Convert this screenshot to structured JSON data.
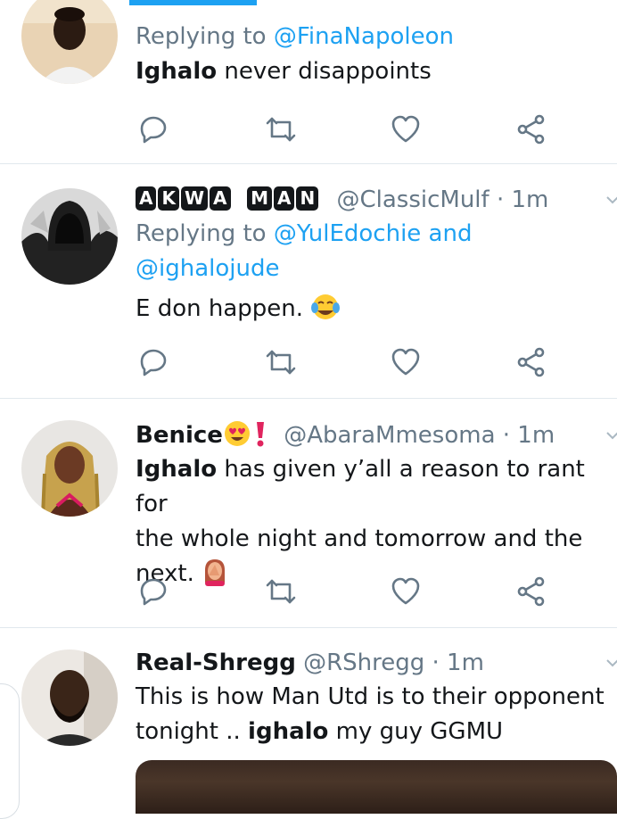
{
  "tweets": [
    {
      "name": "",
      "handle": "",
      "time": "",
      "replying_prefix": "Replying to",
      "replying_to": "@FinaNapoleon",
      "replying_to_2": "",
      "body_bold": "Ighalo",
      "body_rest": " never disappoints",
      "avatar": "man-avatar-light"
    },
    {
      "name_badges": [
        "A",
        "K",
        "W",
        "A",
        "M",
        "A",
        "N"
      ],
      "handle": "@ClassicMulf",
      "time": "· 1m",
      "replying_prefix": "Replying to",
      "replying_to": "@YulEdochie and",
      "replying_to_2": "@ighalojude",
      "body": "E don happen.",
      "emoji": "face-with-tears-of-joy-icon",
      "avatar": "hooded-figure-avatar"
    },
    {
      "name": "Benice",
      "name_emojis": [
        "heart-eyes-icon",
        "red-exclamation-icon"
      ],
      "handle": "@AbaraMmesoma",
      "time": "· 1m",
      "body_bold": "Ighalo",
      "body_line1": " has given y’all a reason to rant for",
      "body_line2": "the whole night and tomorrow and the",
      "body_line3": "next.",
      "emoji": "woman-facepalming-icon",
      "avatar": "woman-braids-avatar"
    },
    {
      "name": "Real-Shregg",
      "handle": "@RShregg",
      "time": "· 1m",
      "body_line1": "This is how Man Utd is to their opponent",
      "body_line2_pre": "tonight .. ",
      "body_bold": "ighalo",
      "body_line2_post": " my guy GGMU",
      "avatar": "bearded-man-avatar"
    }
  ],
  "colors": {
    "accent": "#1da1f2",
    "secondary": "#657786",
    "divider": "#e1e8ed"
  }
}
